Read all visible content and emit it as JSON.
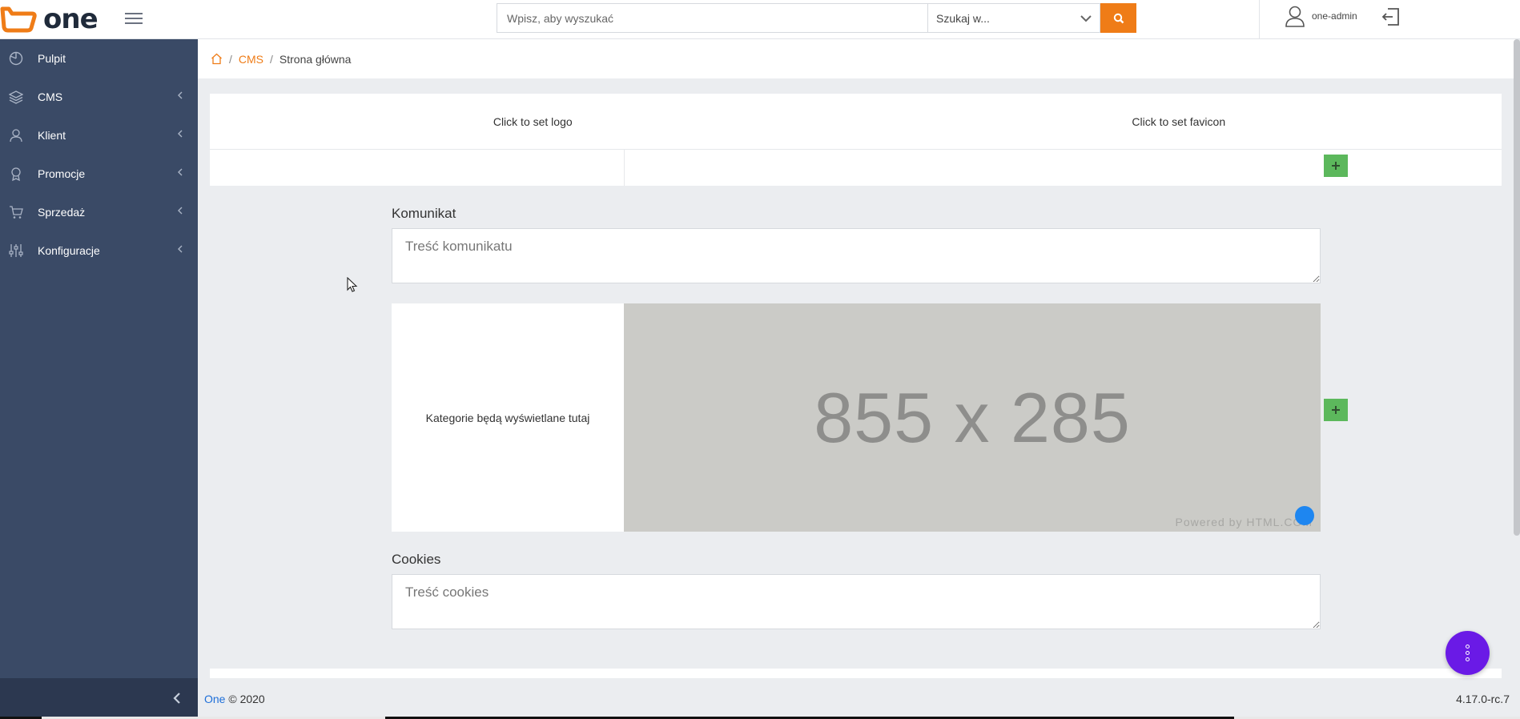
{
  "app": {
    "logo_text": "one",
    "brand_color": "#ef7c17",
    "sidebar_color": "#3a4a66"
  },
  "search": {
    "placeholder": "Wpisz, aby wyszukać",
    "scope_label": "Szukaj w...",
    "button_icon": "search-icon"
  },
  "user": {
    "name": "one-admin",
    "icon": "user-icon",
    "logout_icon": "logout-icon"
  },
  "sidebar": {
    "items": [
      {
        "label": "Pulpit",
        "icon": "dashboard-icon",
        "has_children": false
      },
      {
        "label": "CMS",
        "icon": "layers-icon",
        "has_children": true
      },
      {
        "label": "Klient",
        "icon": "users-icon",
        "has_children": true
      },
      {
        "label": "Promocje",
        "icon": "award-icon",
        "has_children": true
      },
      {
        "label": "Sprzedaż",
        "icon": "cart-icon",
        "has_children": true
      },
      {
        "label": "Konfiguracje",
        "icon": "sliders-icon",
        "has_children": true
      }
    ],
    "collapse_icon": "chevron-left-icon"
  },
  "breadcrumb": {
    "home_icon": "home-icon",
    "items": [
      "CMS",
      "Strona główna"
    ]
  },
  "header_card": {
    "logo_label": "Click to set logo",
    "favicon_label": "Click to set favicon"
  },
  "komunikat": {
    "label": "Komunikat",
    "placeholder": "Treść komunikatu"
  },
  "banner": {
    "categories_text": "Kategorie będą wyświetlane tutaj",
    "placeholder_size": "855 x 285",
    "powered_by": "Powered by HTML.COM"
  },
  "cookies": {
    "label": "Cookies",
    "placeholder": "Treść cookies"
  },
  "footer": {
    "brand": "One",
    "copyright": "© 2020",
    "version": "4.17.0-rc.7"
  }
}
